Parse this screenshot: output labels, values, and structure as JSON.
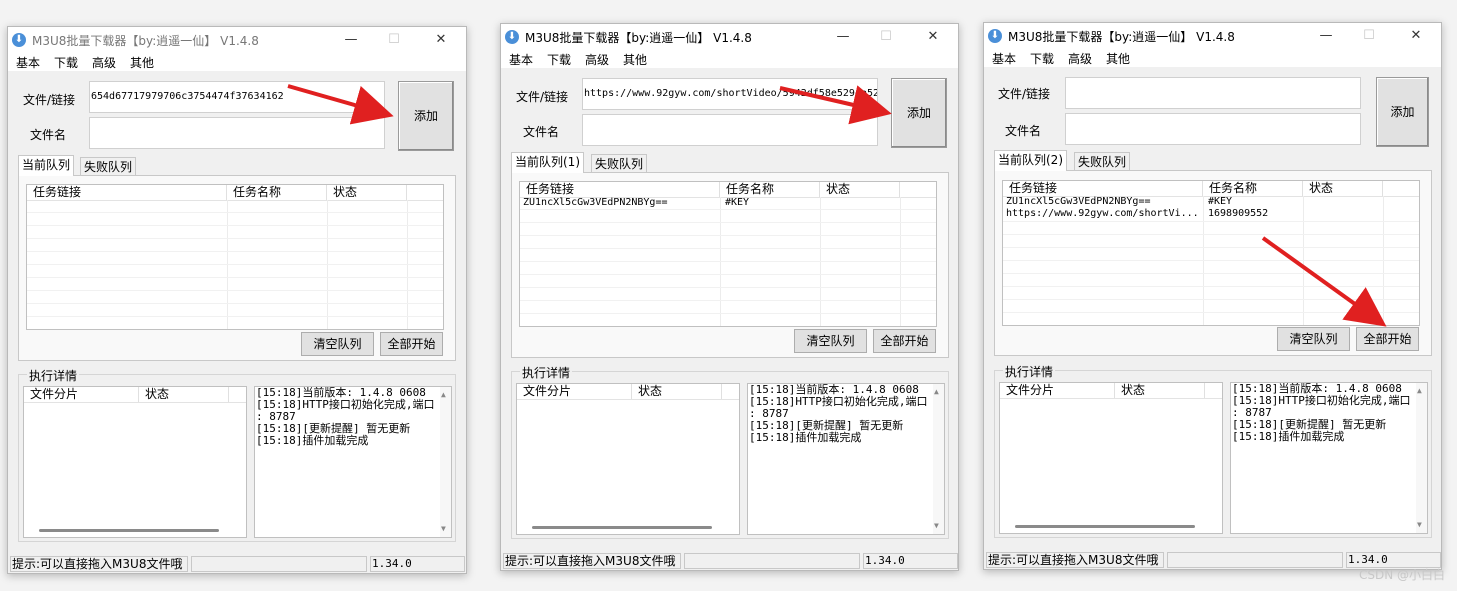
{
  "app": {
    "title": "M3U8批量下载器【by:逍遥一仙】 V1.4.8",
    "icon": "download-icon",
    "minimize": "—",
    "maximize": "☐",
    "close": "✕"
  },
  "menu": [
    "基本",
    "下载",
    "高级",
    "其他"
  ],
  "form": {
    "link_label": "文件/链接",
    "name_label": "文件名",
    "add_button": "添加"
  },
  "tabs": {
    "failed": "失败队列"
  },
  "columns": {
    "task_link": "任务链接",
    "task_name": "任务名称",
    "status": "状态"
  },
  "buttons": {
    "clear": "清空队列",
    "start_all": "全部开始"
  },
  "details": {
    "title": "执行详情",
    "col_part": "文件分片",
    "col_status": "状态",
    "log": [
      "[15:18]当前版本: 1.4.8 0608",
      "[15:18]HTTP接口初始化完成,端口",
      ": 8787",
      "[15:18][更新提醒] 暂无更新",
      "[15:18]插件加载完成"
    ]
  },
  "status": {
    "hint": "提示:可以直接拖入M3U8文件哦",
    "version": "1.34.0"
  },
  "windows": [
    {
      "link_value": "654d67717979706c3754474f37634162",
      "name_value": "",
      "current_tab": "当前队列",
      "rows": []
    },
    {
      "link_value": "https://www.92gyw.com/shortVideo/5942df58e5294a52",
      "name_value": "",
      "current_tab": "当前队列(1)",
      "rows": [
        {
          "link": "ZU1ncXl5cGw3VEdPN2NBYg==",
          "name": "#KEY"
        }
      ]
    },
    {
      "link_value": "",
      "name_value": "",
      "current_tab": "当前队列(2)",
      "rows": [
        {
          "link": "ZU1ncXl5cGw3VEdPN2NBYg==",
          "name": "#KEY"
        },
        {
          "link": "https://www.92gyw.com/shortVi...",
          "name": "1698909552"
        }
      ]
    }
  ],
  "colors": {
    "arrow": "#e02020",
    "accent": "#4a8fd8"
  },
  "watermark": "CSDN @小白白"
}
